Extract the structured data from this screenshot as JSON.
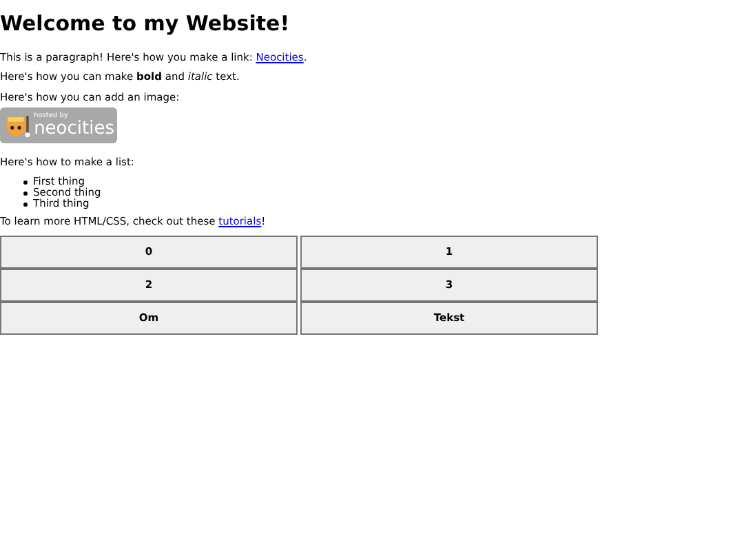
{
  "heading": "Welcome to my Website!",
  "intro": {
    "before": "This is a paragraph! Here's how you make a link: ",
    "link": "Neocities",
    "after": "."
  },
  "formatting": "Here's how you can make **bold** and *italic* text.",
  "image_caption": "Here's how you can add an image:",
  "badge": {
    "top": "hosted by",
    "bottom": "neocities"
  },
  "list_caption": "Here's how to make a list:",
  "list": [
    "First thing",
    "Second thing",
    "Third thing"
  ],
  "outro": {
    "before": "To learn more HTML/CSS, check out these ",
    "link": "tutorials",
    "after": "!"
  },
  "buttons": [
    "0",
    "1",
    "2",
    "3",
    "Om",
    "Tekst"
  ]
}
